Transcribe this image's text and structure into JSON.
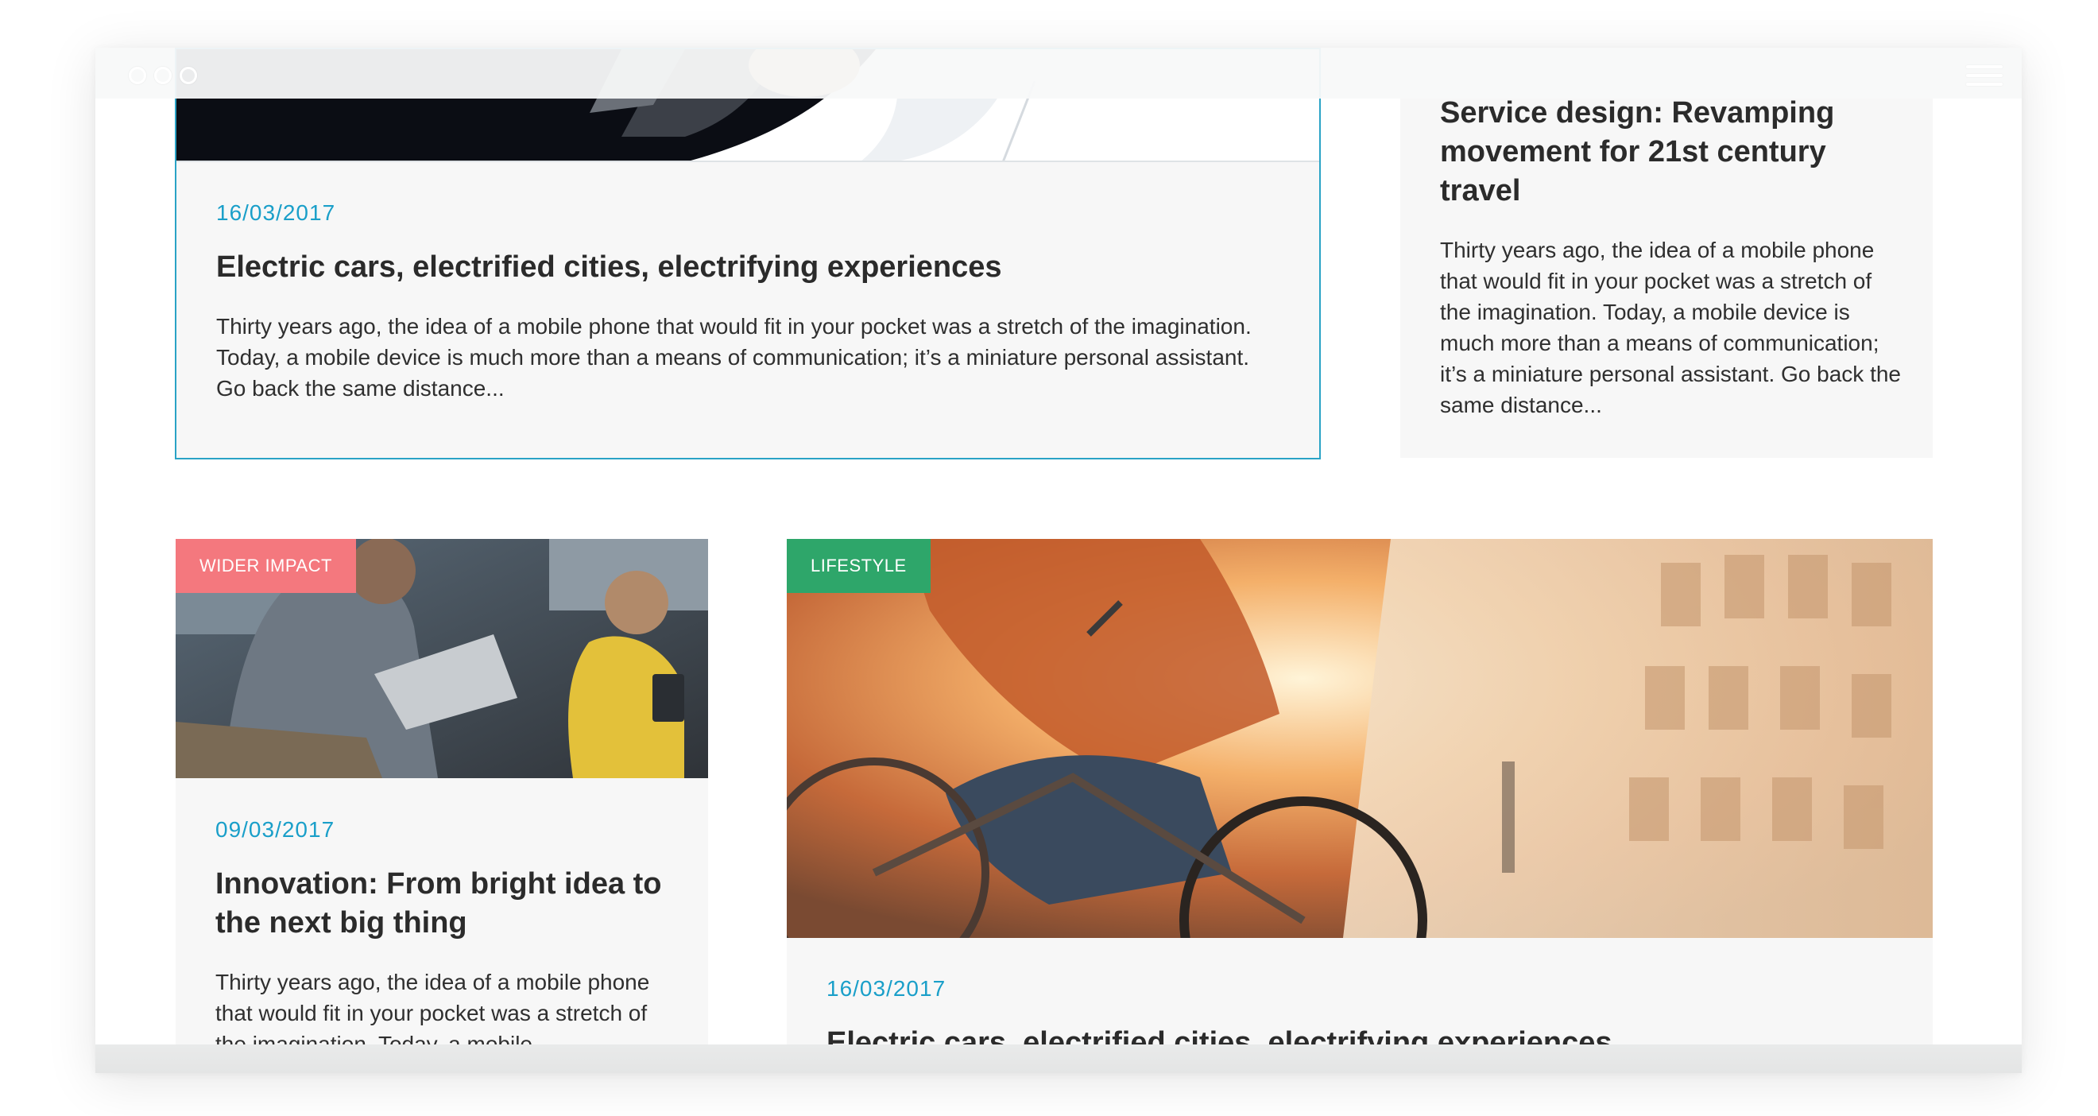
{
  "window": {
    "controls": [
      "close",
      "minimize",
      "maximize"
    ],
    "menu_icon": "hamburger-menu-icon"
  },
  "cards": {
    "featured": {
      "date": "16/03/2017",
      "title": "Electric cars, electrified cities, electrifying experiences",
      "excerpt": "Thirty years ago, the idea of a mobile phone that would fit in your pocket was a stretch of the imagination. Today, a mobile device is much more than a means of communication; it’s a miniature personal assistant. Go back the same distance...",
      "highlight_color": "#2aa3c6"
    },
    "service_design": {
      "title": "Service design: Revamping movement for 21st century travel",
      "excerpt": "Thirty years ago, the idea of a mobile phone that would fit in your pocket was a stretch of the imagination. Today, a mobile device is much more than a means of communication; it’s a miniature personal assistant. Go back the same distance..."
    },
    "innovation": {
      "tag": "WIDER IMPACT",
      "tag_color": "#f4787e",
      "date": "09/03/2017",
      "title": "Innovation: From bright idea to the next big thing",
      "excerpt": "Thirty years ago, the idea of a mobile phone that would fit in your pocket was a stretch of the imagination. Today, a mobile"
    },
    "lifestyle": {
      "tag": "LIFESTYLE",
      "tag_color": "#2ea66a",
      "date": "16/03/2017",
      "title": "Electric cars, electrified cities, electrifying experiences"
    }
  },
  "colors": {
    "date": "#1a9fc9",
    "card_background": "#f7f7f7",
    "text": "#2b2b2b"
  }
}
